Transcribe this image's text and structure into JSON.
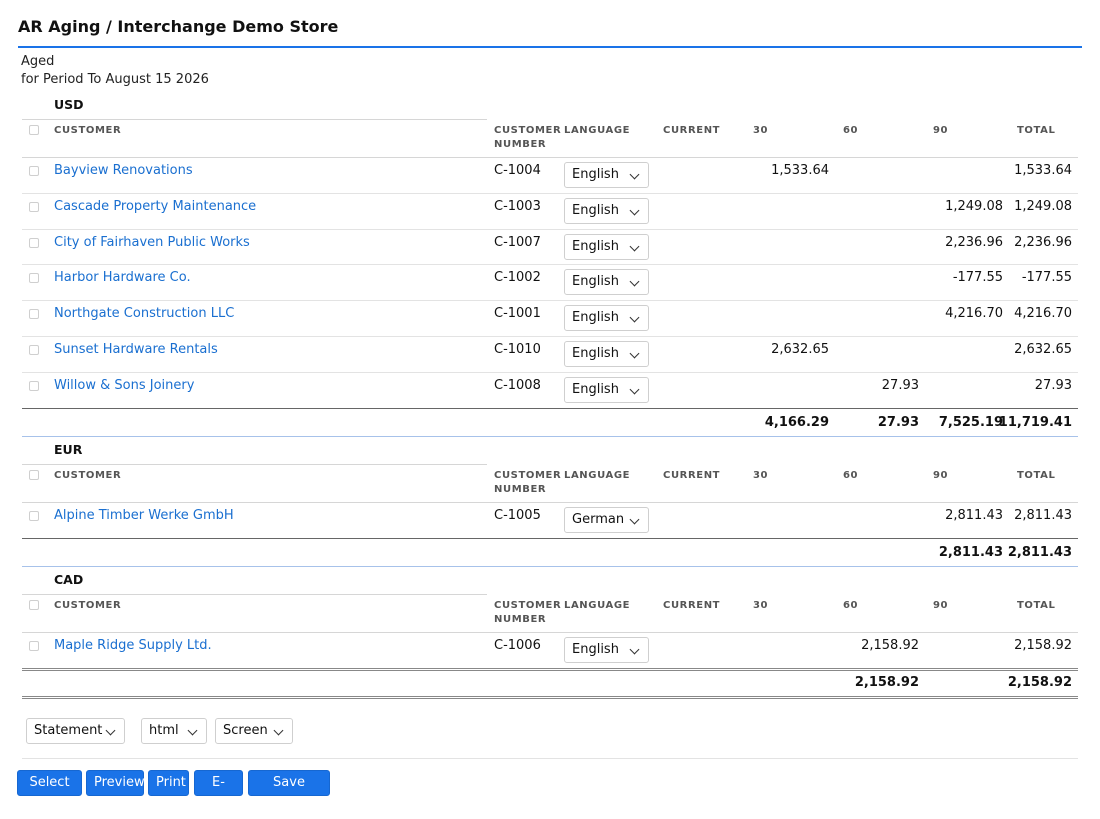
{
  "page": {
    "title": "AR Aging / Interchange Demo Store",
    "report_type": "Aged",
    "period": "for Period To August 15 2026"
  },
  "columns": {
    "customer": "CUSTOMER",
    "customer_number_1": "CUSTOMER",
    "customer_number_2": "NUMBER",
    "language": "LANGUAGE",
    "current": "CURRENT",
    "d30": "30",
    "d60": "60",
    "d90": "90",
    "total": "TOTAL"
  },
  "sections": [
    {
      "currency": "USD",
      "rows": [
        {
          "customer": "Bayview Renovations",
          "number": "C-1004",
          "language": "English",
          "current": "",
          "d30": "1,533.64",
          "d60": "",
          "d90": "",
          "total": "1,533.64"
        },
        {
          "customer": "Cascade Property Maintenance",
          "number": "C-1003",
          "language": "English",
          "current": "",
          "d30": "",
          "d60": "",
          "d90": "1,249.08",
          "total": "1,249.08"
        },
        {
          "customer": "City of Fairhaven Public Works",
          "number": "C-1007",
          "language": "English",
          "current": "",
          "d30": "",
          "d60": "",
          "d90": "2,236.96",
          "total": "2,236.96"
        },
        {
          "customer": "Harbor Hardware Co.",
          "number": "C-1002",
          "language": "English",
          "current": "",
          "d30": "",
          "d60": "",
          "d90": "-177.55",
          "total": "-177.55"
        },
        {
          "customer": "Northgate Construction LLC",
          "number": "C-1001",
          "language": "English",
          "current": "",
          "d30": "",
          "d60": "",
          "d90": "4,216.70",
          "total": "4,216.70"
        },
        {
          "customer": "Sunset Hardware Rentals",
          "number": "C-1010",
          "language": "English",
          "current": "",
          "d30": "2,632.65",
          "d60": "",
          "d90": "",
          "total": "2,632.65"
        },
        {
          "customer": "Willow & Sons Joinery",
          "number": "C-1008",
          "language": "English",
          "current": "",
          "d30": "",
          "d60": "27.93",
          "d90": "",
          "total": "27.93"
        }
      ],
      "totals": {
        "current": "",
        "d30": "4,166.29",
        "d60": "27.93",
        "d90": "7,525.19",
        "total": "11,719.41"
      }
    },
    {
      "currency": "EUR",
      "rows": [
        {
          "customer": "Alpine Timber Werke GmbH",
          "number": "C-1005",
          "language": "German",
          "current": "",
          "d30": "",
          "d60": "",
          "d90": "2,811.43",
          "total": "2,811.43"
        }
      ],
      "totals": {
        "current": "",
        "d30": "",
        "d60": "",
        "d90": "2,811.43",
        "total": "2,811.43"
      }
    },
    {
      "currency": "CAD",
      "rows": [
        {
          "customer": "Maple Ridge Supply Ltd.",
          "number": "C-1006",
          "language": "English",
          "current": "",
          "d30": "",
          "d60": "2,158.92",
          "d90": "",
          "total": "2,158.92"
        }
      ],
      "totals": {
        "current": "",
        "d30": "",
        "d60": "2,158.92",
        "d90": "",
        "total": "2,158.92"
      }
    }
  ],
  "footer": {
    "format_select": "Statement",
    "media_select": "html",
    "output_select": "Screen",
    "buttons": [
      "Select all",
      "Preview",
      "Print",
      "E-mail",
      "Save Report"
    ]
  },
  "colors": {
    "accent": "#1a73e8",
    "link": "#1a6fd0"
  },
  "icons": {
    "select_arrow": "chevron-down-icon",
    "row_select": "checkbox"
  }
}
